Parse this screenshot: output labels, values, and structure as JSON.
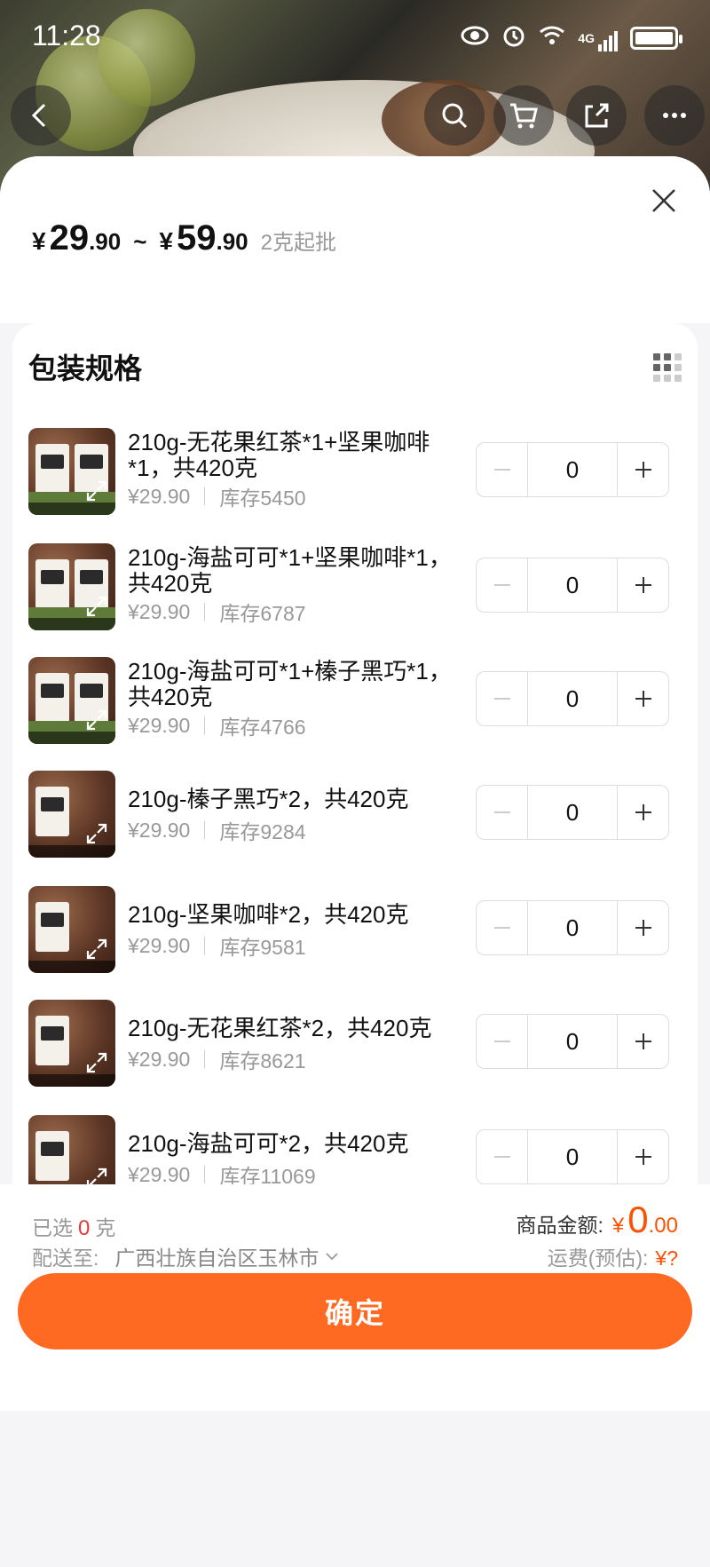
{
  "status_bar": {
    "time": "11:28",
    "network": "4G"
  },
  "nav": {
    "back_icon": "chevron-left-icon",
    "search_icon": "search-icon",
    "cart_icon": "cart-icon",
    "share_icon": "share-icon",
    "more_icon": "more-icon"
  },
  "price": {
    "currency": "¥",
    "low_int": "29",
    "low_dec": ".90",
    "sep": "~",
    "high_int": "59",
    "high_dec": ".90",
    "min_order": "2克起批"
  },
  "section": {
    "title": "包装规格"
  },
  "items": [
    {
      "name": "210g-无花果红茶*1+坚果咖啡*1，共420克",
      "price": "¥29.90",
      "stock": "库存5450",
      "qty": "0"
    },
    {
      "name": "210g-海盐可可*1+坚果咖啡*1，共420克",
      "price": "¥29.90",
      "stock": "库存6787",
      "qty": "0"
    },
    {
      "name": "210g-海盐可可*1+榛子黑巧*1，共420克",
      "price": "¥29.90",
      "stock": "库存4766",
      "qty": "0"
    },
    {
      "name": "210g-榛子黑巧*2，共420克",
      "price": "¥29.90",
      "stock": "库存9284",
      "qty": "0"
    },
    {
      "name": "210g-坚果咖啡*2，共420克",
      "price": "¥29.90",
      "stock": "库存9581",
      "qty": "0"
    },
    {
      "name": "210g-无花果红茶*2，共420克",
      "price": "¥29.90",
      "stock": "库存8621",
      "qty": "0"
    },
    {
      "name": "210g-海盐可可*2，共420克",
      "price": "¥29.90",
      "stock": "库存11069",
      "qty": "0"
    }
  ],
  "footer": {
    "selected_label": "已选",
    "selected_count": "0",
    "selected_unit": "克",
    "ship_label": "配送至:",
    "ship_address": "广西壮族自治区玉林市",
    "amount_label": "商品金额:",
    "amount_currency": "¥",
    "amount_int": "0",
    "amount_dec": ".00",
    "freight_label": "运费(预估):",
    "freight_value": "¥?",
    "confirm_label": "确定"
  },
  "colors": {
    "accent": "#ff6a22",
    "price_red": "#ff5000",
    "selected_red": "#e53935"
  }
}
